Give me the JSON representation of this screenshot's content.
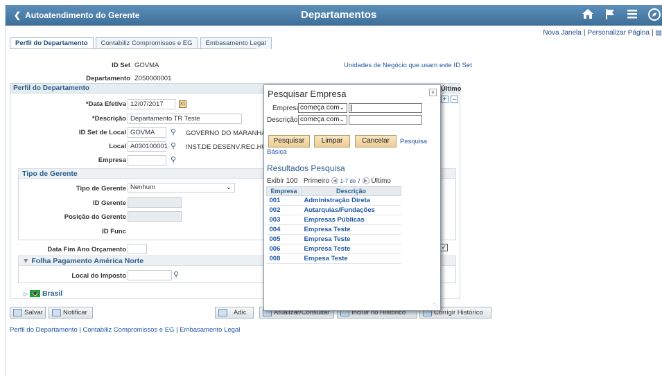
{
  "header": {
    "back_label": "Autoatendimento do Gerente",
    "title": "Departamentos",
    "icons": [
      "home-icon",
      "flag-icon",
      "menu-icon",
      "compass-icon"
    ]
  },
  "toplinks": {
    "new_window": "Nova Janela",
    "personalize": "Personalizar Página"
  },
  "tabs": [
    "Perfil do Departamento",
    "Contabiliz Compromissos e EG",
    "Embasamento Legal"
  ],
  "form": {
    "set_id_label": "ID Set",
    "set_id_value": "GOVMA",
    "business_units_link": "Unidades de Negócio que usam este ID Set",
    "dept_label": "Departamento",
    "dept_value": "Z050000001",
    "profile_section": "Perfil do Departamento",
    "history_label": "Último",
    "effective_date_label": "*Data Efetiva",
    "effective_date_value": "12/07/2017",
    "description_label": "*Descrição",
    "description_value": "Departamento TR Teste",
    "location_setid_label": "ID Set de Local",
    "location_setid_value": "GOVMA",
    "location_setid_desc": "GOVERNO DO MARANHÃO",
    "location_label": "Local",
    "location_value": "A030100001",
    "location_desc": "INST.DE DESENV.REC.HU",
    "company_label": "Empresa",
    "company_value": "",
    "manager_type_section": "Tipo de Gerente",
    "manager_type_label": "Tipo de Gerente",
    "manager_type_value": "Nenhum",
    "manager_id_label": "ID Gerente",
    "manager_position_label": "Posição do Gerente",
    "func_id_label": "ID Func",
    "budget_end_label": "Data Fim Ano Orçamento",
    "payroll_section": "Folha Pagamento América Norte",
    "tax_location_label": "Local do Imposto",
    "brazil_label": "Brasil"
  },
  "buttons": {
    "save": "Salvar",
    "notify": "Notificar",
    "add": "Adic",
    "update": "Atualizar/Consultar",
    "include_history": "Incluir no Histórico",
    "correct_history": "Corrigir Histórico"
  },
  "footer_links": [
    "Perfil do Departamento",
    "Contabiliz Compromissos e EG",
    "Embasamento Legal"
  ],
  "modal": {
    "title": "Pesquisar Empresa",
    "empresa_label": "Empresa",
    "empresa_op": "começa com",
    "descricao_label": "Descrição",
    "descricao_op": "começa com",
    "search_btn": "Pesquisar",
    "clear_btn": "Limpar",
    "cancel_btn": "Cancelar",
    "basic_search_link_1": "Pesquisa",
    "basic_search_link_2": "Básica",
    "results_title": "Resultados Pesquisa",
    "show_label": "Exibir 100",
    "first_label": "Primeiro",
    "range_label": "1-7 de 7",
    "last_label": "Último",
    "col_company": "Empresa",
    "col_desc": "Descrição",
    "rows": [
      {
        "code": "001",
        "desc": "Administração Direta"
      },
      {
        "code": "002",
        "desc": "Autarquias/Fundações"
      },
      {
        "code": "003",
        "desc": "Empresas Públicas"
      },
      {
        "code": "004",
        "desc": "Empresa Teste"
      },
      {
        "code": "005",
        "desc": "Empresa Teste"
      },
      {
        "code": "006",
        "desc": "Empresa Teste"
      },
      {
        "code": "008",
        "desc": "Empesa Teste"
      }
    ]
  }
}
